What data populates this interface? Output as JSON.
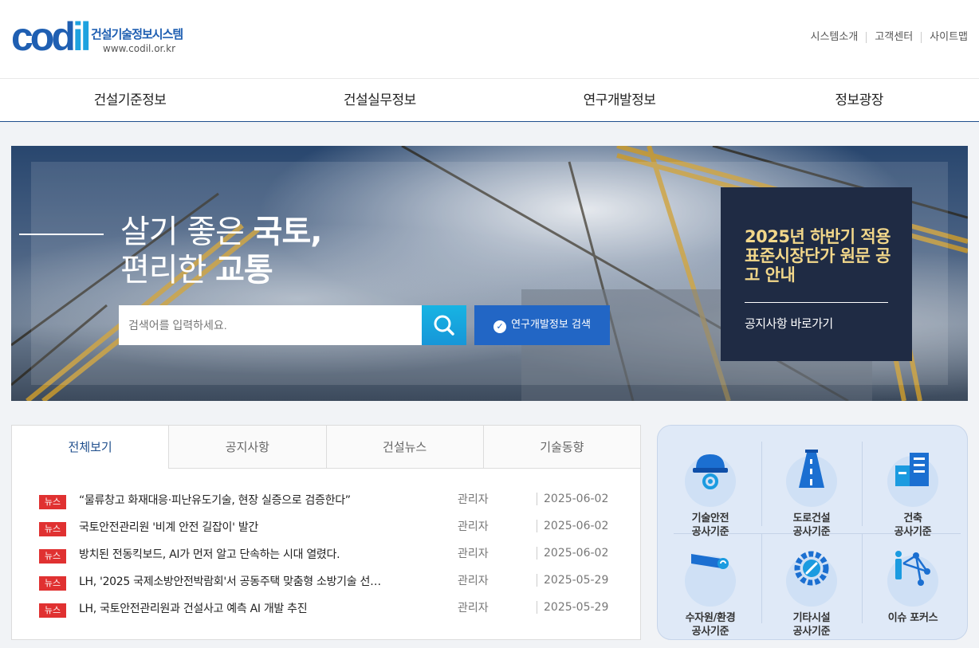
{
  "header": {
    "logo_mark": "codil",
    "logo_title": "건설기술정보시스템",
    "logo_url": "www.codil.or.kr",
    "util_links": [
      "시스템소개",
      "고객센터",
      "사이트맵"
    ]
  },
  "nav": [
    "건설기준정보",
    "건설실무정보",
    "연구개발정보",
    "정보광장"
  ],
  "hero": {
    "line1_light": "살기 좋은 ",
    "line1_bold": "국토,",
    "line2_light": "편리한 ",
    "line2_bold": "교통",
    "search_placeholder": "검색어를 입력하세요.",
    "rnd_button": "연구개발정보 검색",
    "notice_title": "2025년 하반기 적용 표준시장단가 원문 공고 안내",
    "notice_link": "공지사항 바로가기"
  },
  "board": {
    "tabs": [
      "전체보기",
      "공지사항",
      "건설뉴스",
      "기술동향"
    ],
    "active_tab": "전체보기",
    "rows": [
      {
        "badge": "뉴스",
        "title": "“물류창고 화재대응·피난유도기술, 현장 실증으로 검증한다”",
        "author": "관리자",
        "date": "2025-06-02"
      },
      {
        "badge": "뉴스",
        "title": "국토안전관리원 '비계 안전 길잡이' 발간",
        "author": "관리자",
        "date": "2025-06-02"
      },
      {
        "badge": "뉴스",
        "title": "방치된 전동킥보드, AI가 먼저 알고 단속하는 시대 열렸다.",
        "author": "관리자",
        "date": "2025-06-02"
      },
      {
        "badge": "뉴스",
        "title": "LH, '2025 국제소방안전박람회'서 공동주택 맞춤형 소방기술 선…",
        "author": "관리자",
        "date": "2025-05-29"
      },
      {
        "badge": "뉴스",
        "title": "LH, 국토안전관리원과 건설사고 예측 AI 개발 추진",
        "author": "관리자",
        "date": "2025-05-29"
      }
    ]
  },
  "quick_links": [
    {
      "label": "기술안전\n공사기준",
      "icon": "safety-helmet-icon"
    },
    {
      "label": "도로건설\n공사기준",
      "icon": "road-icon"
    },
    {
      "label": "건축\n공사기준",
      "icon": "building-icon"
    },
    {
      "label": "수자원/환경\n공사기준",
      "icon": "water-pipe-icon"
    },
    {
      "label": "기타시설\n공사기준",
      "icon": "gear-wrench-icon"
    },
    {
      "label": "이슈 포커스",
      "icon": "network-person-icon"
    }
  ],
  "colors": {
    "brand_blue": "#1f5fb2",
    "accent_cyan": "#17b4e3",
    "rnd_blue": "#2266c5",
    "notice_bg": "#1f2b44",
    "notice_gold": "#f2d78a",
    "badge_red": "#e03131"
  }
}
